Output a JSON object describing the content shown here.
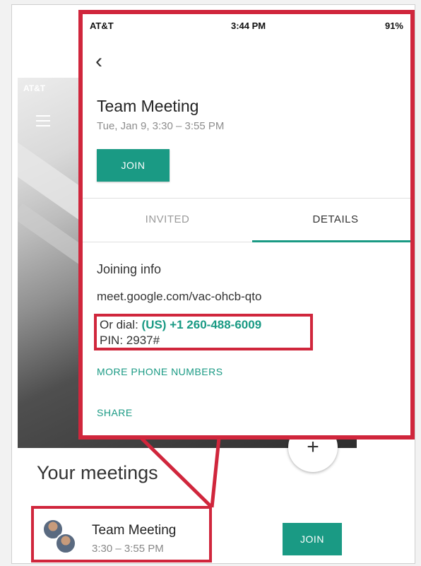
{
  "background": {
    "status_text": "AT&T",
    "fab_symbol": "+",
    "section_title": "Your meetings",
    "meeting": {
      "title": "Team Meeting",
      "time": "3:30 – 3:55 PM",
      "join_label": "JOIN"
    }
  },
  "popup": {
    "status": {
      "carrier": "AT&T",
      "time": "3:44 PM",
      "battery": "91%"
    },
    "back_symbol": "‹",
    "title": "Team Meeting",
    "date": "Tue, Jan 9, 3:30 – 3:55 PM",
    "join_label": "JOIN",
    "tabs": {
      "invited": "INVITED",
      "details": "DETAILS"
    },
    "joining": {
      "heading": "Joining info",
      "url": "meet.google.com/vac-ohcb-qto",
      "dial_prefix": "Or dial:",
      "dial_number": "(US) +1 260-488-6009",
      "pin": "PIN: 2937#",
      "more_link": "MORE PHONE NUMBERS",
      "share_link": "SHARE"
    }
  },
  "colors": {
    "accent": "#1a9a84",
    "highlight": "#d0263c"
  }
}
